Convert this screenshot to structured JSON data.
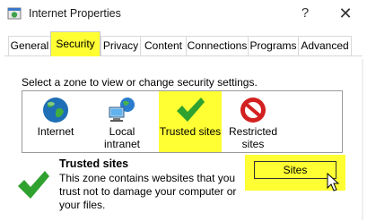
{
  "window": {
    "title": "Internet Properties",
    "help_label": "?",
    "close_label": "✕"
  },
  "tabs": [
    {
      "label": "General",
      "active": false
    },
    {
      "label": "Security",
      "active": true
    },
    {
      "label": "Privacy",
      "active": false
    },
    {
      "label": "Content",
      "active": false
    },
    {
      "label": "Connections",
      "active": false
    },
    {
      "label": "Programs",
      "active": false
    },
    {
      "label": "Advanced",
      "active": false
    }
  ],
  "security": {
    "instruction": "Select a zone to view or change security settings.",
    "zones": [
      {
        "label": "Internet",
        "icon": "globe-icon",
        "selected": false
      },
      {
        "label": "Local intranet",
        "icon": "network-icon",
        "selected": false
      },
      {
        "label": "Trusted sites",
        "icon": "green-check-icon",
        "selected": true
      },
      {
        "label": "Restricted sites",
        "icon": "no-entry-icon",
        "selected": false
      }
    ],
    "selected_zone": {
      "title": "Trusted sites",
      "description": "This zone contains websites that you trust not to damage your computer or your files.",
      "sites_button_label": "Sites"
    }
  },
  "colors": {
    "highlight": "#ffff33",
    "check_green": "#2fa12f",
    "restricted_red": "#d32020"
  }
}
